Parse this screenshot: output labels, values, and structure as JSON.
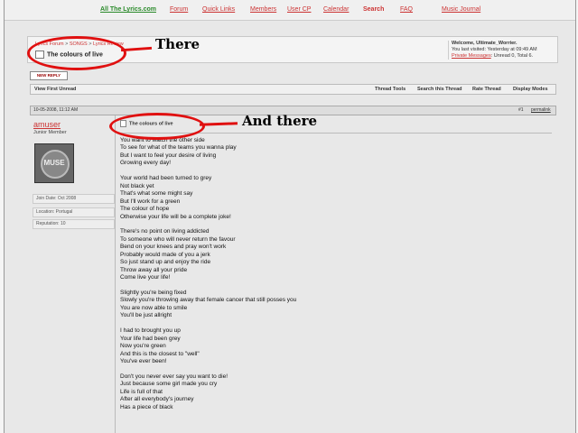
{
  "topnav": {
    "brand": "All The Lyrics.com",
    "links": [
      "Forum",
      "Quick Links",
      "Members",
      "User CP",
      "Calendar",
      "Search",
      "FAQ",
      "Music Journal"
    ]
  },
  "breadcrumb": [
    "Lyrics Forum",
    "SONGS",
    "Lyrics Review"
  ],
  "page_title": "The colours of live",
  "welcome": {
    "heading": "Welcome, Ultimate_Worrier.",
    "last_visited": "You last visited: Yesterday at 09:49 AM",
    "pm_label": "Private Messages",
    "pm_counts": ": Unread 0, Total 6."
  },
  "reply_button": "NEW REPLY",
  "tools": {
    "view_first_unread": "View First Unread",
    "thread_tools": "Thread Tools",
    "search_thread": "Search this Thread",
    "rate_thread": "Rate Thread",
    "display_modes": "Display Modes"
  },
  "post": {
    "date": "10-05-2008, 11:12 AM",
    "number": "#1",
    "permalink": "permalink",
    "title": "The colours of live",
    "lines": [
      "You want to watch the other side",
      "To see for what of the teams you wanna play",
      "But I want to feel your desire of living",
      "Growing every day!",
      "",
      "Your world had been turned to grey",
      "Not black yet",
      "That's what some might say",
      "But I'll work for a green",
      "The colour of hope",
      "Otherwise your life will be a complete joke!",
      "",
      "There's no point on living addicted",
      "To someone who will never return the favour",
      "Bend on your knees and pray won't work",
      "Probably would made of you a jerk",
      "So just stand up and enjoy the ride",
      "Throw away all your pride",
      "Come live your life!",
      "",
      "Slightly you're being fixed",
      "Slowly you're throwing away that female cancer that still posses you",
      "You are now able to smile",
      "You'll be just allright",
      "",
      "I had to brought you up",
      "Your life had been grey",
      "Now you're green",
      "And this is the closest to \"well\"",
      "You've ever been!",
      "",
      "Don't you never ever say you want to die!",
      "Just because some girl made you cry",
      "Life is full of that",
      "After all everybody's journey",
      "Has a piece of black"
    ]
  },
  "user": {
    "name": "amuser",
    "title": "Junior Member",
    "avatar_text": "MUSE",
    "join_date": "Join Date: Oct 2008",
    "location": "Location: Portugal",
    "reputation": "Reputation: 10"
  },
  "annotations": {
    "there": "There",
    "and_there": "And there"
  },
  "colors": {
    "annotation_red": "#e01010",
    "link_red": "#cc3333",
    "brand_green": "#2a8a2a"
  }
}
